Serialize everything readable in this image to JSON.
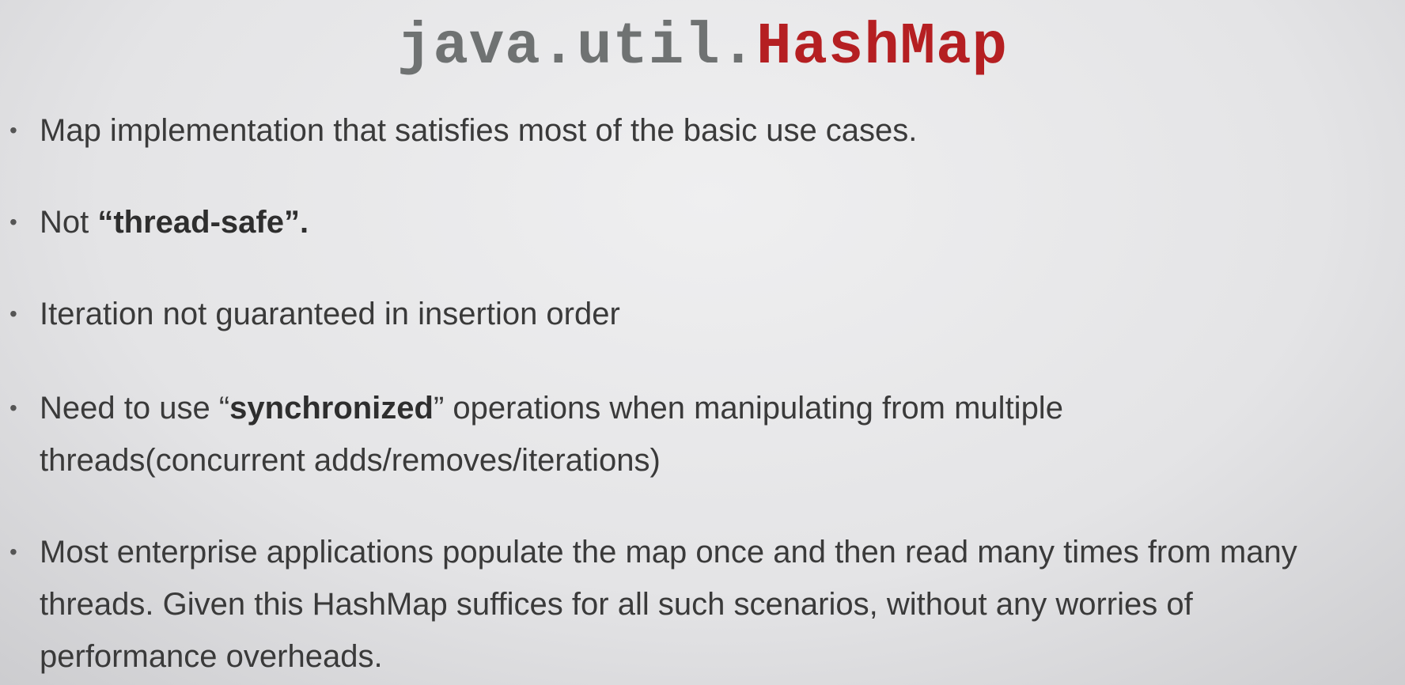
{
  "title": {
    "package": "java.util.",
    "class_name": "HashMap"
  },
  "bullets": [
    {
      "text": "Map implementation that satisfies most of the basic use cases."
    },
    {
      "pre": "Not ",
      "bold": "“thread-safe”.",
      "post": ""
    },
    {
      "text": "Iteration not guaranteed in insertion order"
    },
    {
      "pre": "Need to use “",
      "bold": "synchronized",
      "post": "” operations when manipulating from multiple",
      "line2": "threads(concurrent adds/removes/iterations)"
    },
    {
      "line1": "Most enterprise applications populate the map once and then read many times from many",
      "line2": "threads. Given this HashMap suffices for all such scenarios, without any worries of",
      "line3": "performance overheads."
    }
  ],
  "bullet_symbol": "•"
}
